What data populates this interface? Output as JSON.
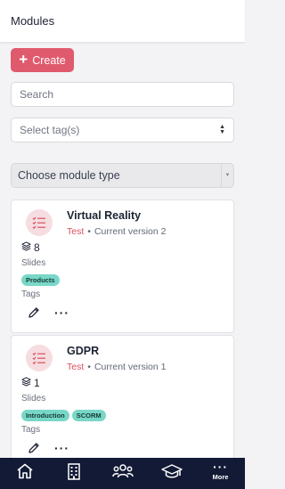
{
  "header": {
    "title": "Modules"
  },
  "toolbar": {
    "create_label": "Create"
  },
  "search": {
    "placeholder": "Search"
  },
  "tag_select": {
    "placeholder": "Select tag(s)"
  },
  "type_select": {
    "placeholder": "Choose module type"
  },
  "colors": {
    "accent": "#e05a6d",
    "chip": "#79d7c7",
    "nav_bg": "#121a36",
    "tag_text": "#d8505f"
  },
  "modules": [
    {
      "title": "Virtual Reality",
      "tag": "Test",
      "version": "Current version 2",
      "slides_count": "8",
      "slides_label": "Slides",
      "chips": [
        "Products"
      ],
      "tags_label": "Tags"
    },
    {
      "title": "GDPR",
      "tag": "Test",
      "version": "Current version 1",
      "slides_count": "1",
      "slides_label": "Slides",
      "chips": [
        "Introduction",
        "SCORM"
      ],
      "tags_label": "Tags"
    }
  ],
  "bottom_nav": {
    "items": [
      {
        "icon": "home-icon"
      },
      {
        "icon": "building-icon"
      },
      {
        "icon": "users-icon"
      },
      {
        "icon": "graduation-cap-icon"
      },
      {
        "icon": "more-icon",
        "label": "More"
      }
    ]
  }
}
